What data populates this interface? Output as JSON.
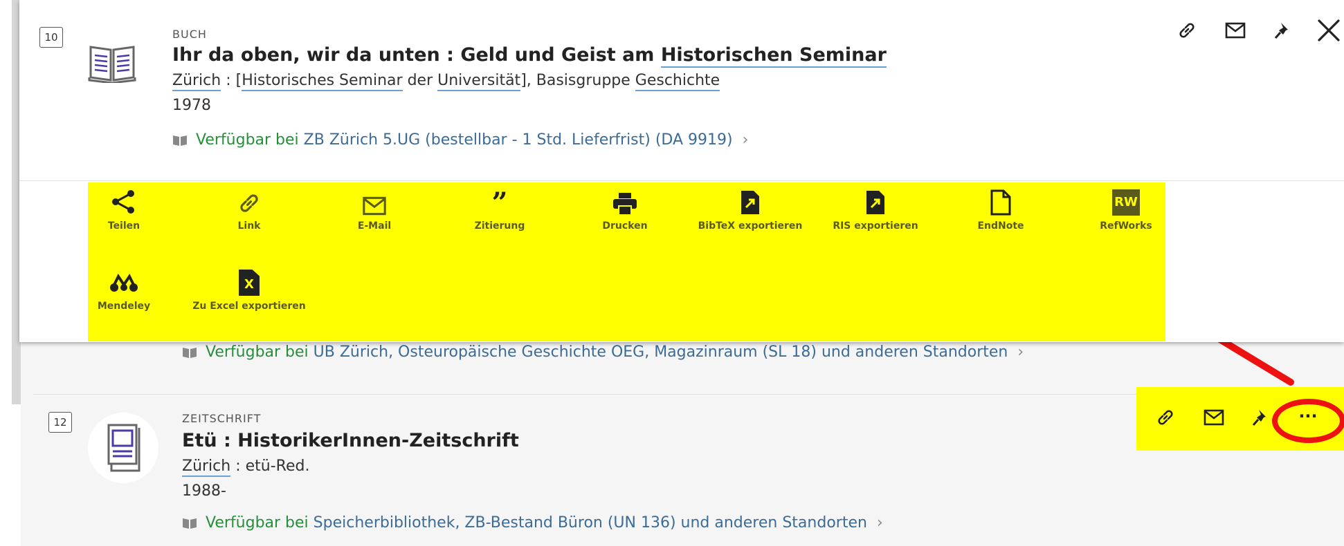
{
  "record10": {
    "number": "10",
    "type": "BUCH",
    "title_a": "Ihr da oben, wir da unten : Geld und Geist am ",
    "title_b": "Historischen Seminar",
    "pub": {
      "p1": "Zürich",
      "p2": " : [",
      "p3": "Historisches Seminar",
      "p4": " der ",
      "p5": "Universität",
      "p6": "], Basisgruppe ",
      "p7": "Geschichte"
    },
    "year": "1978",
    "avail_prefix": "Verfügbar bei",
    "avail_location": "ZB Zürich  5.UG (bestellbar - 1 Std. Lieferfrist) (DA 9919)",
    "chevron": "›"
  },
  "actions": [
    {
      "icon": "share-icon",
      "label": "Teilen"
    },
    {
      "icon": "link-icon",
      "label": "Link"
    },
    {
      "icon": "mail-icon",
      "label": "E-Mail"
    },
    {
      "icon": "quote-icon",
      "label": "Zitierung"
    },
    {
      "icon": "print-icon",
      "label": "Drucken"
    },
    {
      "icon": "bibtex-export-icon",
      "label": "BibTeX exportieren"
    },
    {
      "icon": "ris-export-icon",
      "label": "RIS exportieren"
    },
    {
      "icon": "endnote-icon",
      "label": "EndNote"
    },
    {
      "icon": "refworks-icon",
      "label": "RefWorks",
      "badge": "RW"
    },
    {
      "icon": "mendeley-icon",
      "label": "Mendeley"
    },
    {
      "icon": "excel-export-icon",
      "label": "Zu Excel exportieren",
      "badge": "X"
    }
  ],
  "record11": {
    "avail_prefix": "Verfügbar bei",
    "avail_location": "UB Zürich, Osteuropäische Geschichte  OEG, Magazinraum (SL 18) und anderen Standorten",
    "chevron": "›"
  },
  "record12": {
    "number": "12",
    "type": "ZEITSCHRIFT",
    "title": "Etü : HistorikerInnen-Zeitschrift",
    "pub_place": "Zürich",
    "pub_rest": " : etü-Red.",
    "year": "1988-",
    "avail_prefix": "Verfügbar bei",
    "avail_location": "Speicherbibliothek, ZB-Bestand  Büron (UN 136) und anderen Standorten",
    "chevron": "›",
    "more_label": "···"
  },
  "colors": {
    "highlight": "#ffff00",
    "annotation": "#ee1111",
    "available": "#268f3a",
    "location": "#3c6b96"
  }
}
